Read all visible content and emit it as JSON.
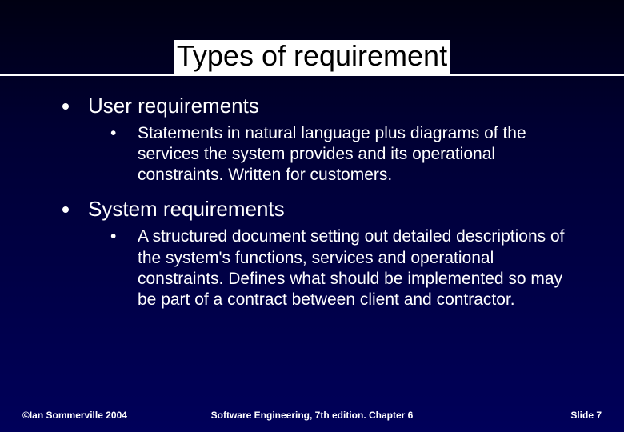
{
  "title": "Types of requirement",
  "bullets": [
    {
      "heading": "User requirements",
      "sub": "Statements in natural language plus diagrams of the services the system provides and its operational constraints. Written for customers."
    },
    {
      "heading": "System requirements",
      "sub": "A structured document setting out detailed descriptions of the system's functions, services and operational constraints. Defines what should be implemented so may be part of a contract between client and contractor."
    }
  ],
  "footer": {
    "left": "©Ian Sommerville 2004",
    "center": "Software Engineering, 7th edition. Chapter 6",
    "right": "Slide  7"
  }
}
